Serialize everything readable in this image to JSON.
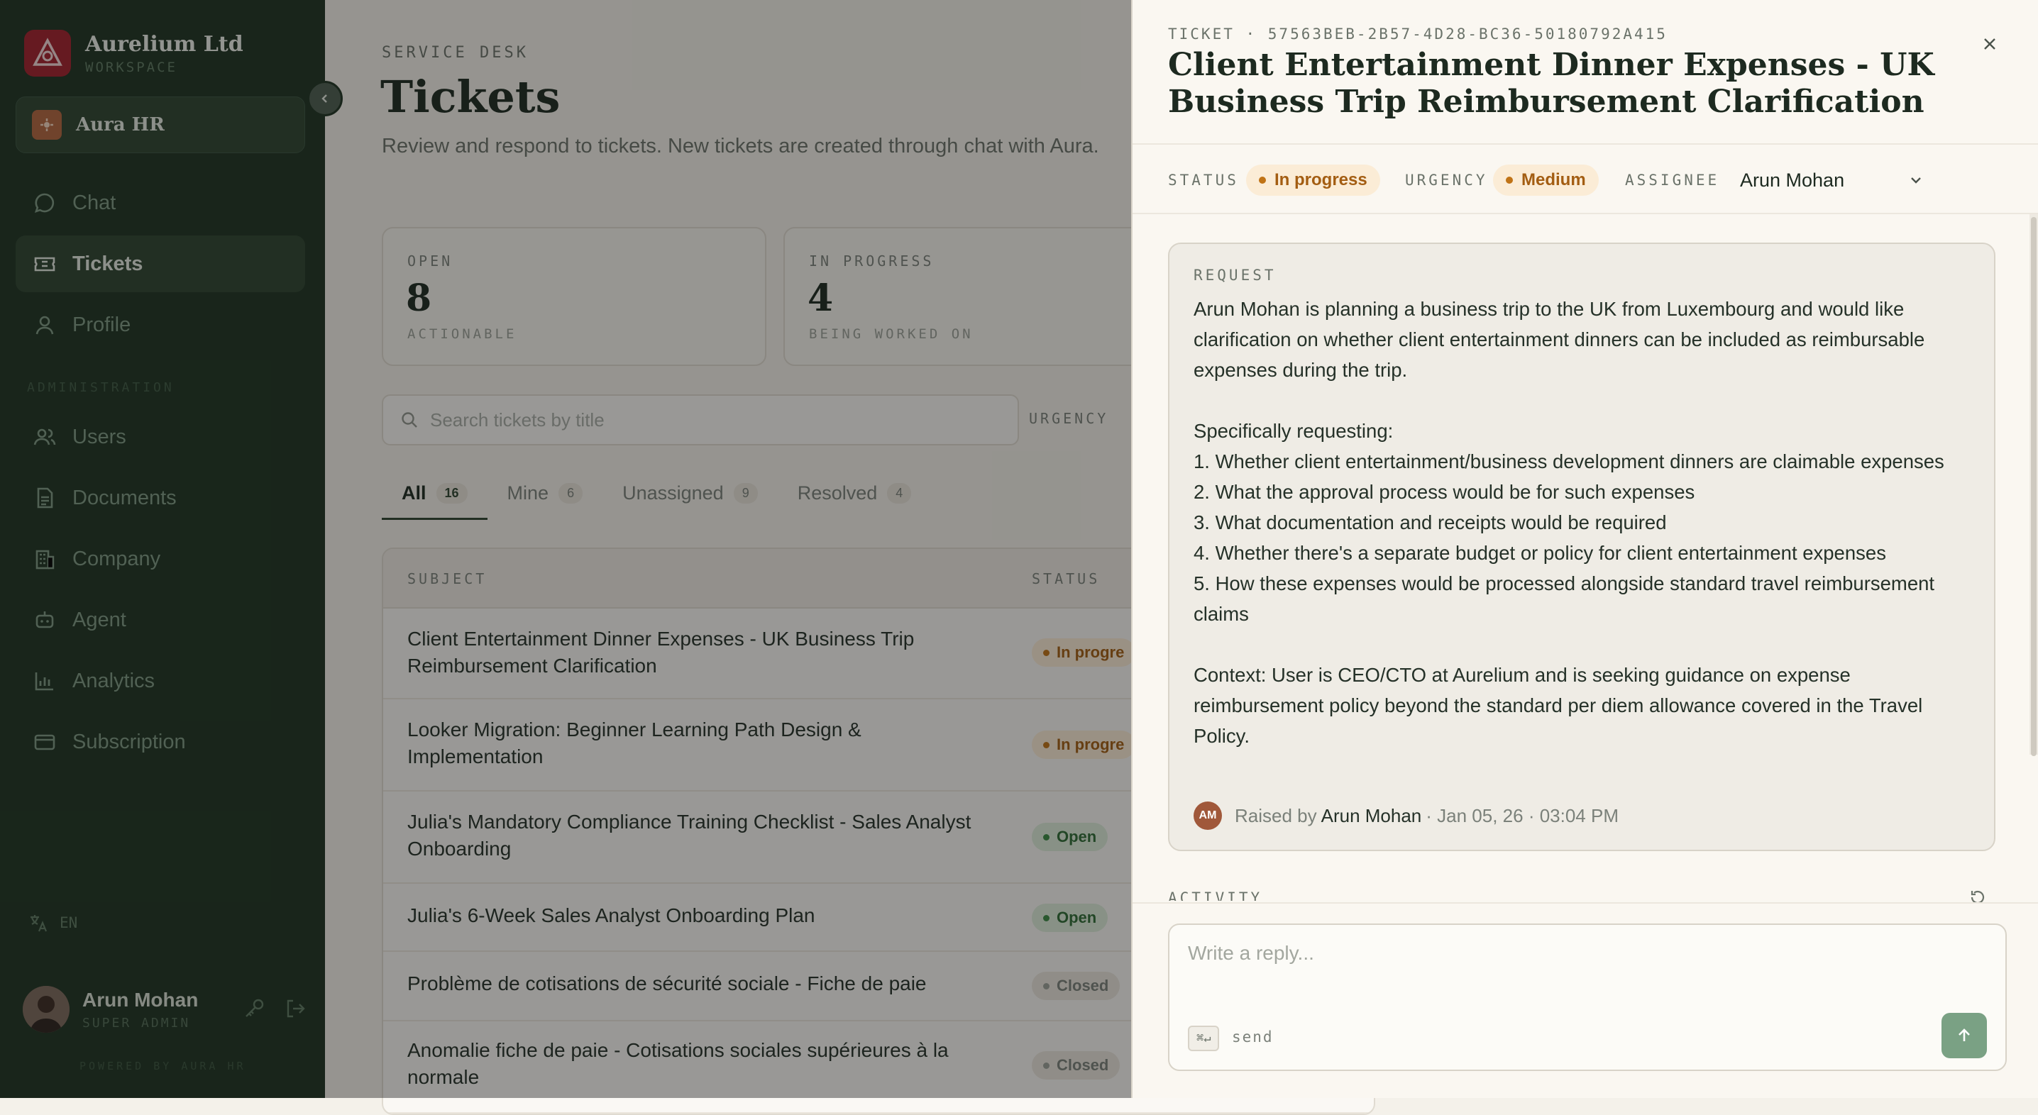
{
  "sidebar": {
    "brand_name": "Aurelium Ltd",
    "brand_sub": "WORKSPACE",
    "workspace_label": "Aura HR",
    "nav": [
      {
        "label": "Chat",
        "icon": "chat-icon"
      },
      {
        "label": "Tickets",
        "icon": "ticket-icon",
        "active": true
      },
      {
        "label": "Profile",
        "icon": "profile-icon"
      }
    ],
    "admin_section": "ADMINISTRATION",
    "admin_nav": [
      {
        "label": "Users",
        "icon": "users-icon"
      },
      {
        "label": "Documents",
        "icon": "document-icon"
      },
      {
        "label": "Company",
        "icon": "building-icon"
      },
      {
        "label": "Agent",
        "icon": "bot-icon"
      },
      {
        "label": "Analytics",
        "icon": "analytics-icon"
      },
      {
        "label": "Subscription",
        "icon": "credit-card-icon"
      }
    ],
    "language": "EN",
    "user": {
      "name": "Arun Mohan",
      "role": "SUPER ADMIN"
    },
    "powered_by": "POWERED BY AURA HR"
  },
  "main": {
    "eyebrow": "SERVICE DESK",
    "title": "Tickets",
    "subtitle": "Review and respond to tickets. New tickets are created through chat with Aura.",
    "stats": [
      {
        "label": "OPEN",
        "value": "8",
        "caption": "ACTIONABLE"
      },
      {
        "label": "IN PROGRESS",
        "value": "4",
        "caption": "BEING WORKED ON"
      }
    ],
    "search_placeholder": "Search tickets by title",
    "urgency_filter_label": "URGENCY",
    "tabs": [
      {
        "label": "All",
        "count": "16",
        "active": true
      },
      {
        "label": "Mine",
        "count": "6"
      },
      {
        "label": "Unassigned",
        "count": "9"
      },
      {
        "label": "Resolved",
        "count": "4"
      }
    ],
    "table": {
      "headers": {
        "subject": "SUBJECT",
        "status": "STATUS"
      },
      "rows": [
        {
          "subject": "Client Entertainment Dinner Expenses - UK Business Trip Reimbursement Clarification",
          "status": "In progre",
          "kind": "progress"
        },
        {
          "subject": "Looker Migration: Beginner Learning Path Design & Implementation",
          "status": "In progre",
          "kind": "progress"
        },
        {
          "subject": "Julia's Mandatory Compliance Training Checklist - Sales Analyst Onboarding",
          "status": "Open",
          "kind": "open"
        },
        {
          "subject": "Julia's 6-Week Sales Analyst Onboarding Plan",
          "status": "Open",
          "kind": "open"
        },
        {
          "subject": "Problème de cotisations de sécurité sociale - Fiche de paie",
          "status": "Closed",
          "kind": "closed"
        },
        {
          "subject": "Anomalie fiche de paie - Cotisations sociales supérieures à la normale",
          "status": "Closed",
          "kind": "closed"
        }
      ]
    }
  },
  "drawer": {
    "ticket_id": "TICKET · 57563BEB-2B57-4D28-BC36-50180792A415",
    "title": "Client Entertainment Dinner Expenses - UK Business Trip Reimbursement Clarification",
    "status_label": "STATUS",
    "status_value": "In progress",
    "urgency_label": "URGENCY",
    "urgency_value": "Medium",
    "assignee_label": "ASSIGNEE",
    "assignee_value": "Arun Mohan",
    "request_label": "REQUEST",
    "request_body": "Arun Mohan is planning a business trip to the UK from Luxembourg and would like clarification on whether client entertainment dinners can be included as reimbursable expenses during the trip.\n\nSpecifically requesting:\n1. Whether client entertainment/business development dinners are claimable expenses\n2. What the approval process would be for such expenses\n3. What documentation and receipts would be required\n4. Whether there's a separate budget or policy for client entertainment expenses\n5. How these expenses would be processed alongside standard travel reimbursement claims\n\nContext: User is CEO/CTO at Aurelium and is seeking guidance on expense reimbursement policy beyond the standard per diem allowance covered in the Travel Policy.",
    "raised_initials": "AM",
    "raised_prefix": "Raised by",
    "raised_name": "Arun Mohan",
    "raised_meta": "· Jan 05, 26 · 03:04 PM",
    "activity_label": "ACTIVITY",
    "reply_placeholder": "Write a reply...",
    "kbd_hint": "⌘↵",
    "send_hint": "send"
  },
  "colors": {
    "sidebar_bg": "#1e3322",
    "accent_red": "#a3202b",
    "progress": "#c07316",
    "open": "#3c8a44",
    "send_button": "#7aa184"
  }
}
